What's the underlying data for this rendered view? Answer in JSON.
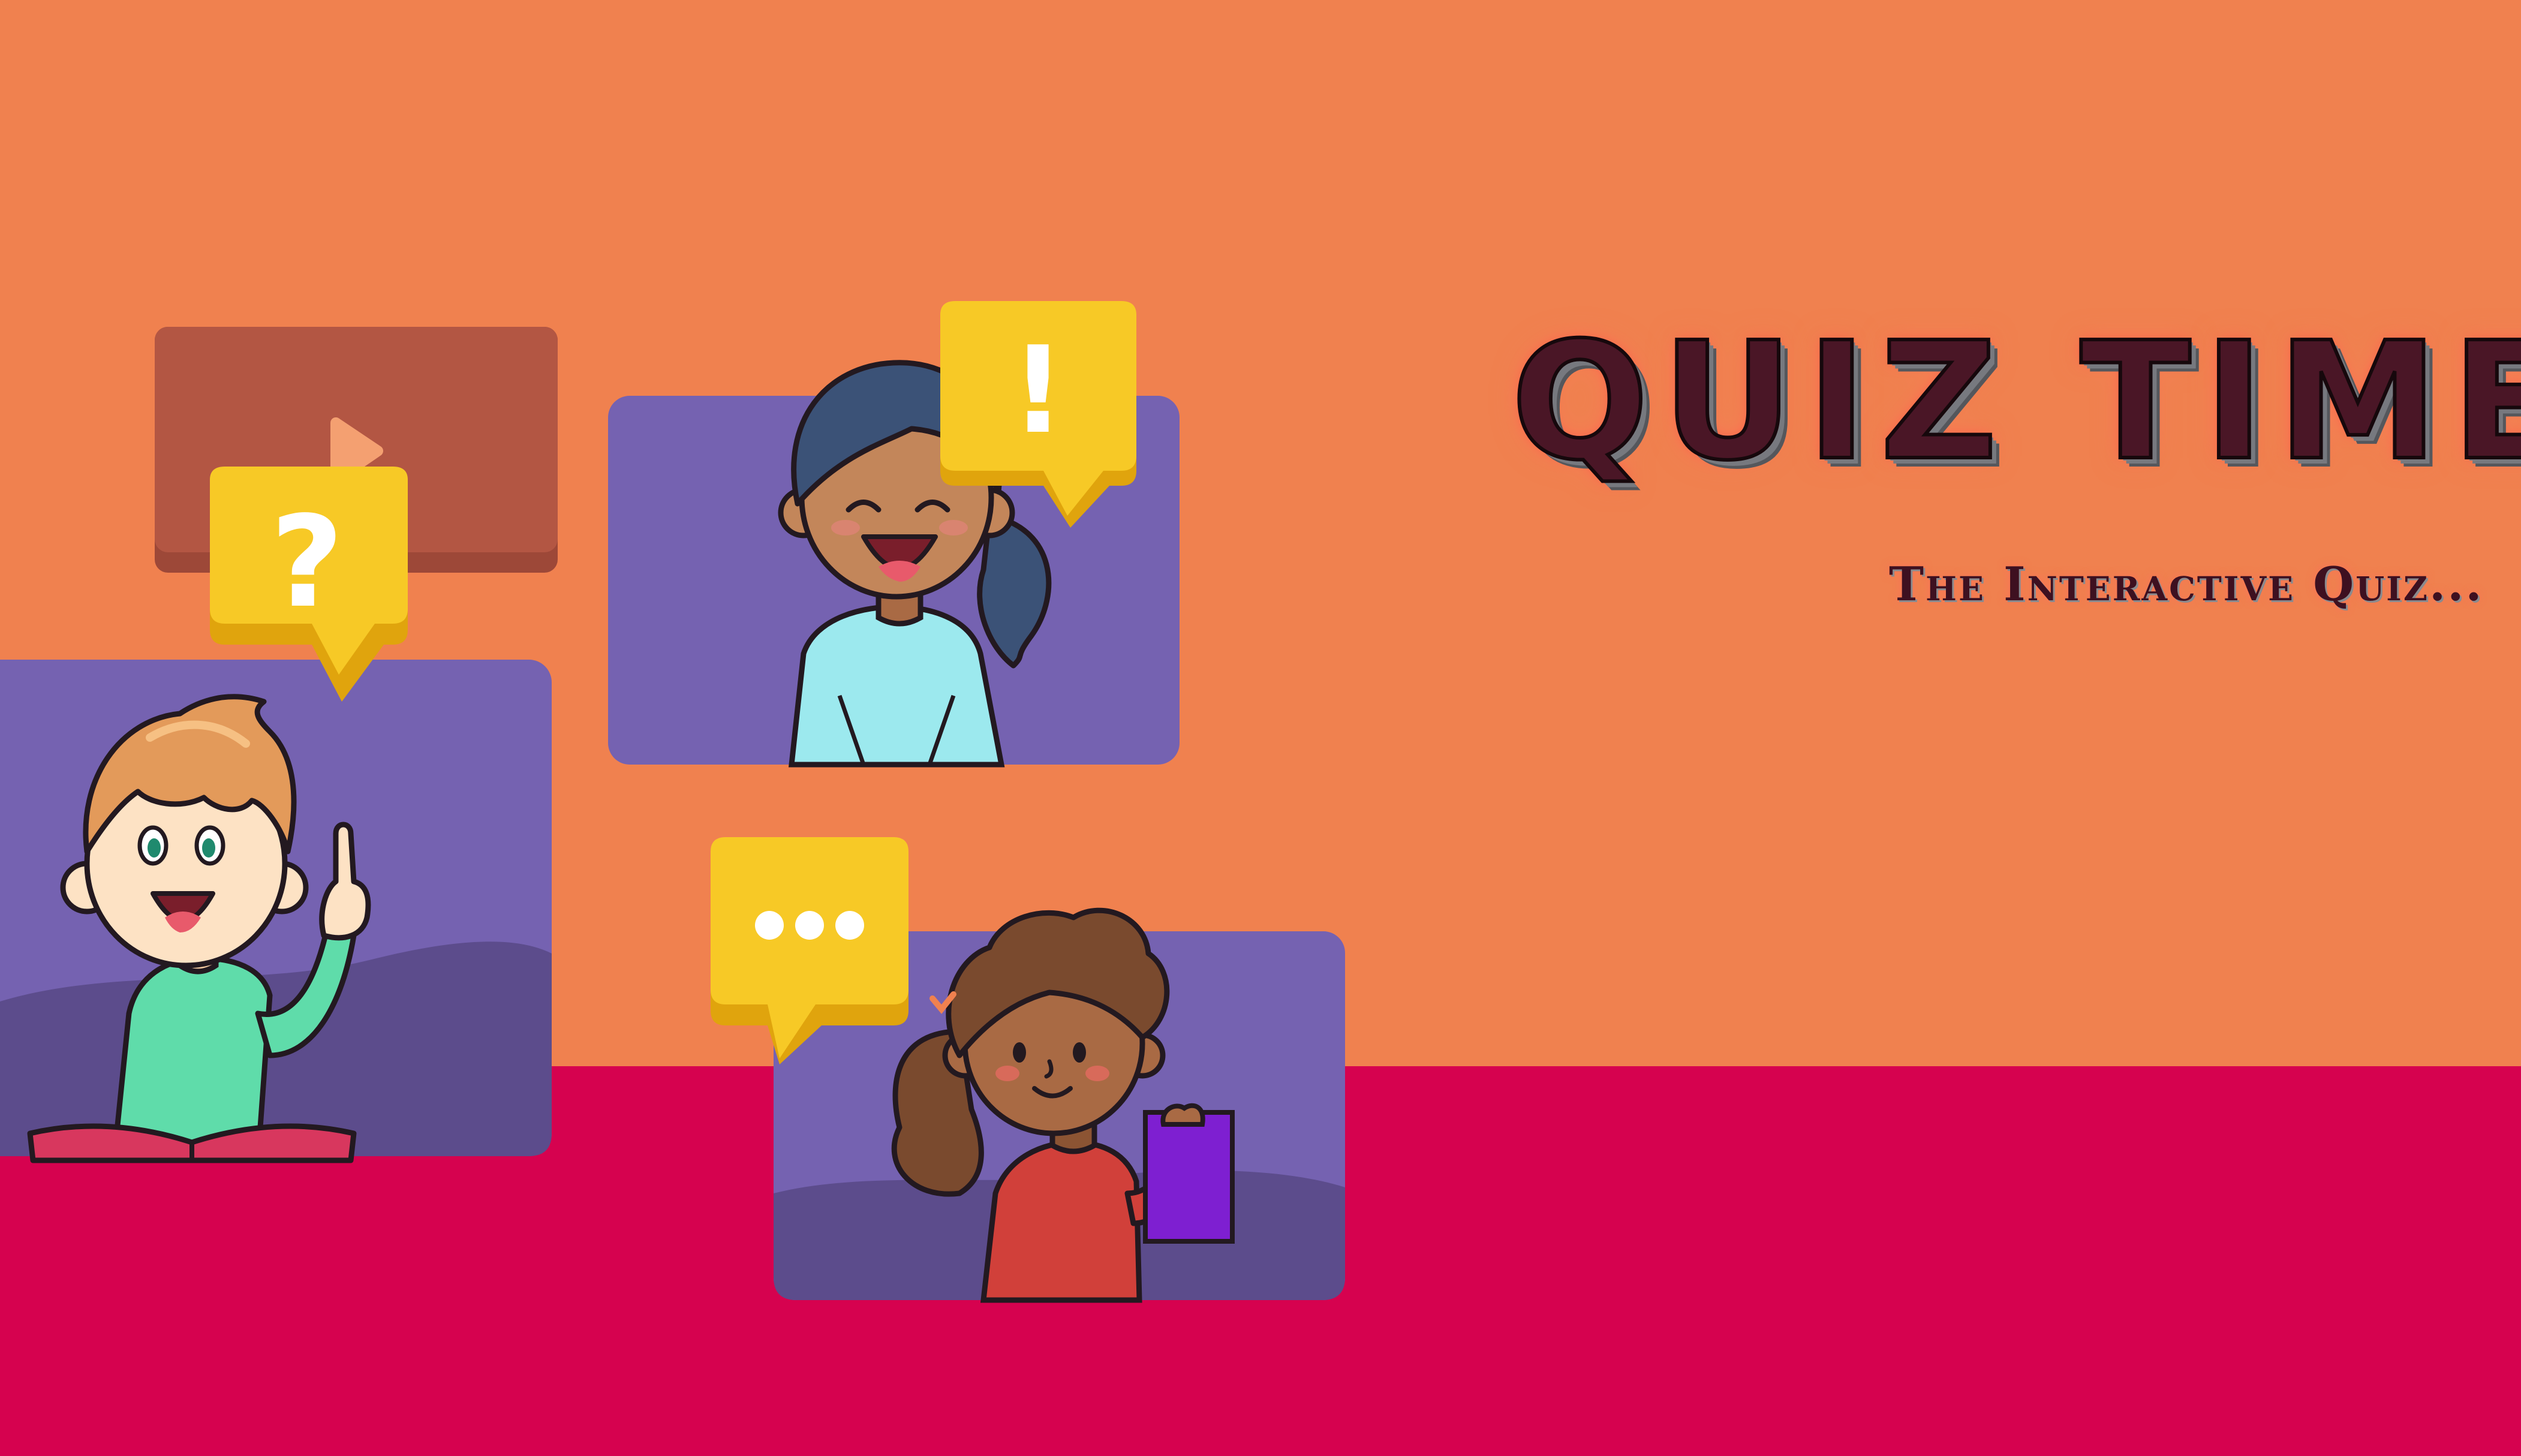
{
  "banner": {
    "title": "Quiz Time",
    "subtitle": "The Interactive Quiz..."
  },
  "bubbles": {
    "question": {
      "glyph": "?"
    },
    "exclamation": {
      "glyph": "!"
    },
    "ellipsis": {
      "glyph": "•••"
    }
  },
  "colors": {
    "background_top": "#f0814f",
    "background_bottom": "#d6024f",
    "card_purple": "#7562b1",
    "card_hill": "#5c4c8c",
    "video_card": "#b35643",
    "bubble_yellow": "#f7c926",
    "bubble_shade": "#e0a40d",
    "outline": "#231920"
  },
  "icons": [
    "play-icon",
    "question-mark-icon",
    "exclamation-mark-icon",
    "ellipsis-icon"
  ]
}
